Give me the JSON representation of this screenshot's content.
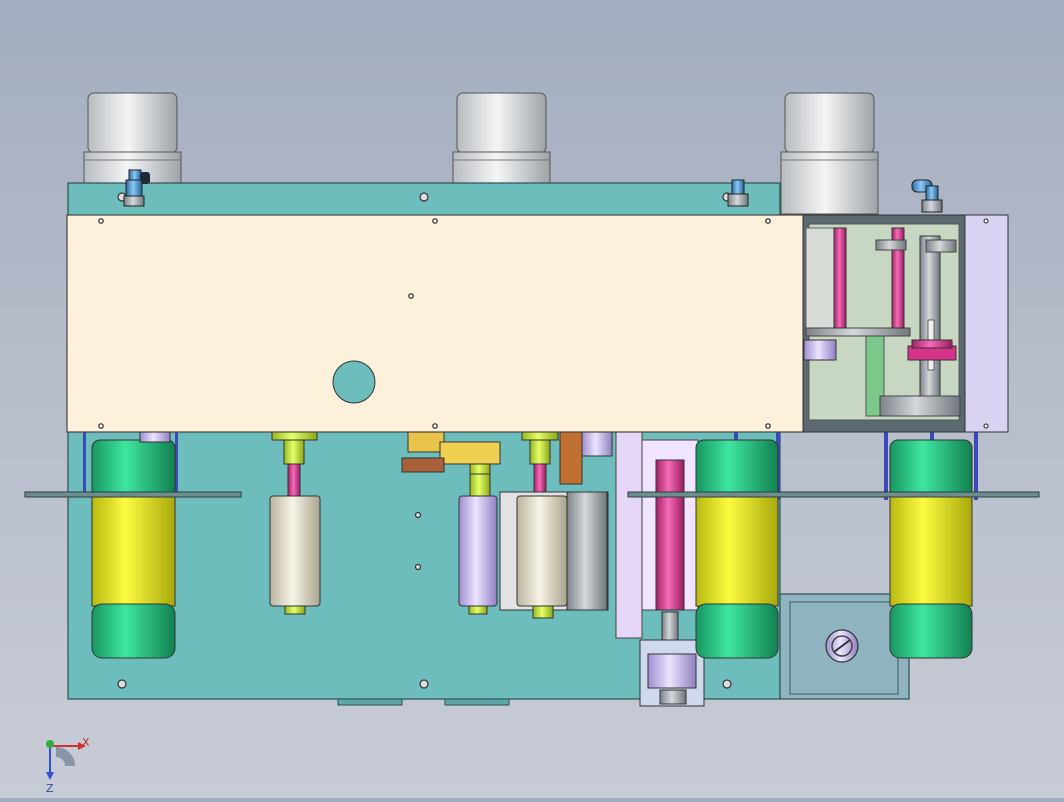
{
  "viewport": {
    "background_top": "#a4adbf",
    "background_bottom": "#c8ccd6"
  },
  "model": {
    "colors": {
      "base_plate": "#6dbdbd",
      "cover_panel": "#fdf1dc",
      "housing": "#c8d7c2",
      "end_plate": "#d9d2f2",
      "cylinder_cap": "#e3e5e7",
      "motor_yellow": "#eeee22",
      "motor_green": "#22cc88",
      "pink_rod": "#e0479a",
      "lime_collar": "#c8ec3a",
      "lavender": "#c9b9f2",
      "brown_bracket": "#c07030",
      "dark_plate": "#607070",
      "pneumatic_fitting": "#4e9ad8"
    }
  },
  "triad": {
    "x_label": "X",
    "z_label": "Z"
  }
}
